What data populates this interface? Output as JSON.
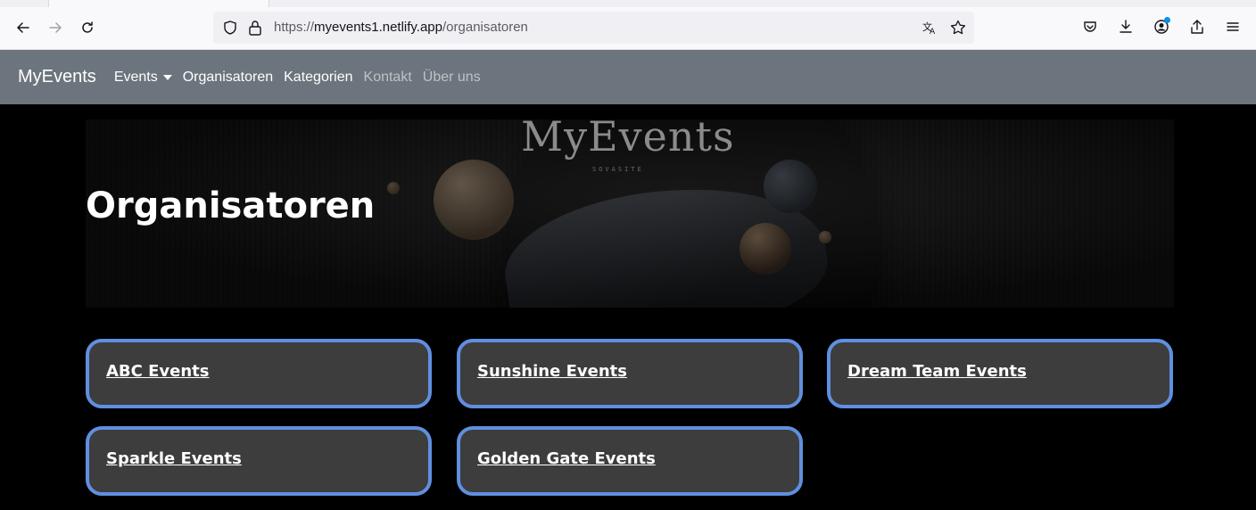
{
  "browser": {
    "url_scheme": "https://",
    "url_host": "myevents1.netlify.app",
    "url_path": "/organisatoren"
  },
  "nav": {
    "brand": "MyEvents",
    "links": [
      {
        "label": "Events",
        "dropdown": true
      },
      {
        "label": "Organisatoren"
      },
      {
        "label": "Kategorien"
      },
      {
        "label": "Kontakt"
      },
      {
        "label": "Über uns"
      }
    ]
  },
  "hero": {
    "logo_text": "MyEvents",
    "logo_sub": "SOVASITE",
    "title": "Organisatoren"
  },
  "organizers": [
    {
      "name": "ABC Events"
    },
    {
      "name": "Sunshine Events"
    },
    {
      "name": "Dream Team Events"
    },
    {
      "name": "Sparkle Events"
    },
    {
      "name": "Golden Gate Events"
    }
  ],
  "colors": {
    "nav_bg": "#6c757d",
    "card_bg": "#3d3d3d",
    "card_border": "#5f8fe0"
  }
}
